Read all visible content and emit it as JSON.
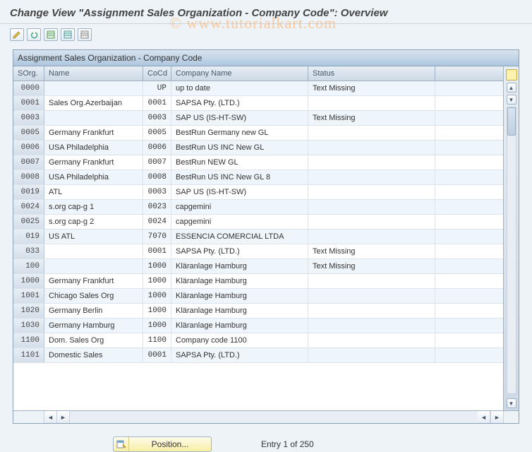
{
  "watermark": "© www.tutorialkart.com",
  "page_title": "Change View \"Assignment Sales Organization - Company Code\": Overview",
  "toolbar_icons": [
    "pencil",
    "undo",
    "sheet-green",
    "sheet-teal",
    "sheet-gray"
  ],
  "table": {
    "caption": "Assignment Sales Organization - Company Code",
    "columns": {
      "sorg": "SOrg.",
      "name": "Name",
      "cocd": "CoCd",
      "cname": "Company Name",
      "status": "Status"
    },
    "rows": [
      {
        "sorg": "0000",
        "name": "",
        "cocd": "UP",
        "cname": "up to date",
        "status": "Text Missing"
      },
      {
        "sorg": "0001",
        "name": "Sales Org.Azerbaijan",
        "cocd": "0001",
        "cname": "SAPSA Pty. (LTD.)",
        "status": ""
      },
      {
        "sorg": "0003",
        "name": "",
        "cocd": "0003",
        "cname": "SAP US (IS-HT-SW)",
        "status": "Text Missing"
      },
      {
        "sorg": "0005",
        "name": "Germany Frankfurt",
        "cocd": "0005",
        "cname": "BestRun Germany new GL",
        "status": ""
      },
      {
        "sorg": "0006",
        "name": "USA Philadelphia",
        "cocd": "0006",
        "cname": "BestRun US INC New GL",
        "status": ""
      },
      {
        "sorg": "0007",
        "name": "Germany Frankfurt",
        "cocd": "0007",
        "cname": "BestRun NEW GL",
        "status": ""
      },
      {
        "sorg": "0008",
        "name": "USA Philadelphia",
        "cocd": "0008",
        "cname": "BestRun US INC New GL 8",
        "status": ""
      },
      {
        "sorg": "0019",
        "name": "ATL",
        "cocd": "0003",
        "cname": "SAP US (IS-HT-SW)",
        "status": ""
      },
      {
        "sorg": "0024",
        "name": "s.org cap-g 1",
        "cocd": "0023",
        "cname": "capgemini",
        "status": ""
      },
      {
        "sorg": "0025",
        "name": "s.org cap-g 2",
        "cocd": "0024",
        "cname": "capgemini",
        "status": ""
      },
      {
        "sorg": "019",
        "name": "US ATL",
        "cocd": "7070",
        "cname": "ESSENCIA COMERCIAL LTDA",
        "status": ""
      },
      {
        "sorg": "033",
        "name": "",
        "cocd": "0001",
        "cname": "SAPSA Pty. (LTD.)",
        "status": "Text Missing"
      },
      {
        "sorg": "100",
        "name": "",
        "cocd": "1000",
        "cname": "Kläranlage Hamburg",
        "status": "Text Missing"
      },
      {
        "sorg": "1000",
        "name": "Germany Frankfurt",
        "cocd": "1000",
        "cname": "Kläranlage Hamburg",
        "status": ""
      },
      {
        "sorg": "1001",
        "name": "Chicago Sales Org",
        "cocd": "1000",
        "cname": "Kläranlage Hamburg",
        "status": ""
      },
      {
        "sorg": "1020",
        "name": "Germany Berlin",
        "cocd": "1000",
        "cname": "Kläranlage Hamburg",
        "status": ""
      },
      {
        "sorg": "1030",
        "name": "Germany Hamburg",
        "cocd": "1000",
        "cname": "Kläranlage Hamburg",
        "status": ""
      },
      {
        "sorg": "1100",
        "name": "Dom. Sales Org",
        "cocd": "1100",
        "cname": "Company code 1100",
        "status": ""
      },
      {
        "sorg": "1101",
        "name": "Domestic Sales",
        "cocd": "0001",
        "cname": "SAPSA Pty. (LTD.)",
        "status": ""
      }
    ]
  },
  "footer": {
    "position_label": "Position...",
    "entry_text": "Entry 1 of 250"
  }
}
